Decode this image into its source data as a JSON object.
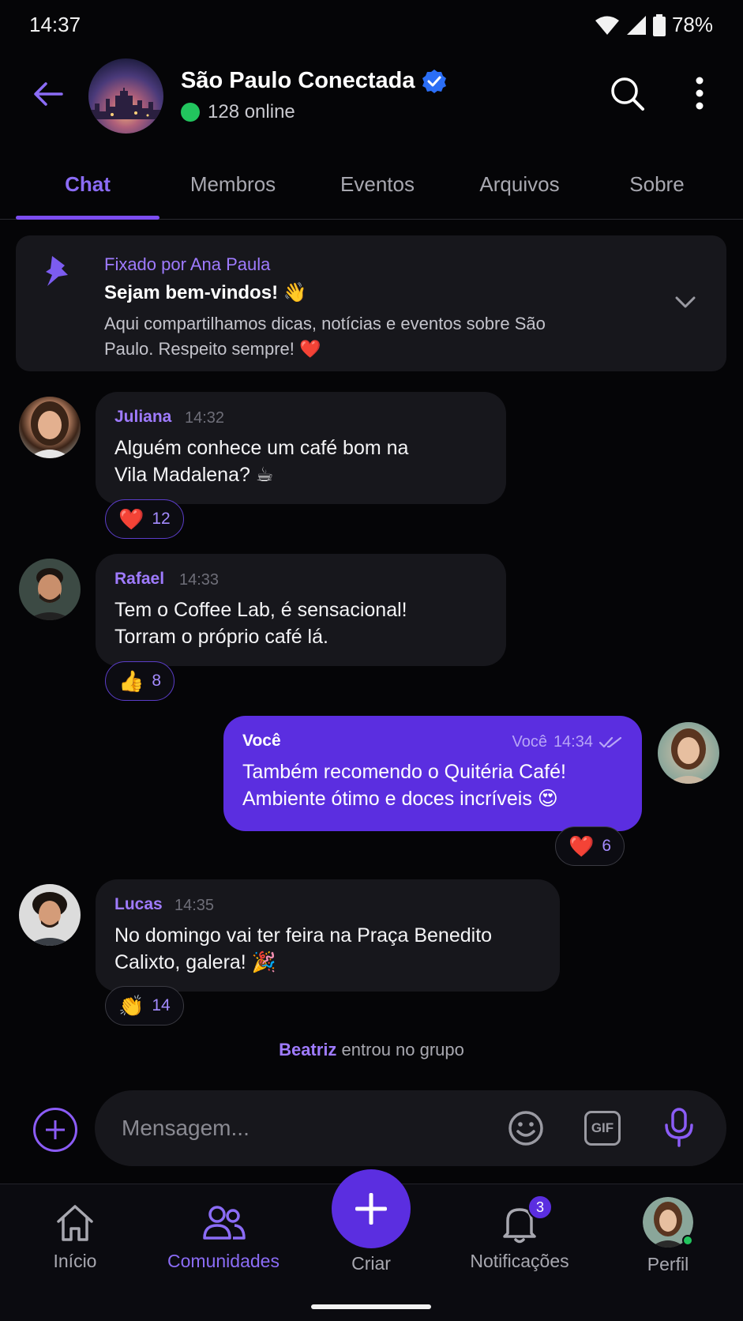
{
  "status_bar": {
    "time": "14:37",
    "battery": "78%"
  },
  "header": {
    "title": "São Paulo Conectada",
    "online": "128 online"
  },
  "tabs": [
    {
      "label": "Chat",
      "active": true
    },
    {
      "label": "Membros"
    },
    {
      "label": "Eventos"
    },
    {
      "label": "Arquivos"
    },
    {
      "label": "Sobre"
    }
  ],
  "pinned": {
    "by": "Fixado por Ana Paula",
    "title": "Sejam bem-vindos! 👋",
    "body": "Aqui compartilhamos dicas, notícias e eventos sobre São Paulo. Respeito sempre! ❤️"
  },
  "messages": [
    {
      "author": "Juliana",
      "time": "14:32",
      "text": "Alguém conhece um café bom na Vila Madalena? ☕",
      "reaction_emoji": "❤️",
      "reaction_count": "12"
    },
    {
      "author": "Rafael",
      "time": "14:33",
      "text": "Tem o Coffee Lab, é sensacional! Torram o próprio café lá.",
      "reaction_emoji": "👍",
      "reaction_count": "8"
    },
    {
      "author": "Você",
      "sender_label": "Você",
      "time": "14:34",
      "text": "Também recomendo o Quitéria Café! Ambiente ótimo e doces incríveis 😍",
      "reaction_emoji": "❤️",
      "reaction_count": "6"
    },
    {
      "author": "Lucas",
      "time": "14:35",
      "text": "No domingo vai ter feira na Praça Benedito Calixto, galera! 🎉",
      "reaction_emoji": "👏",
      "reaction_count": "14"
    }
  ],
  "system": {
    "name": "Beatriz",
    "text": " entrou no grupo"
  },
  "composer": {
    "placeholder": "Mensagem...",
    "gif_label": "GIF"
  },
  "nav": {
    "home": "Início",
    "communities": "Comunidades",
    "create": "Criar",
    "notifications": "Notificações",
    "notifications_badge": "3",
    "profile": "Perfil"
  },
  "colors": {
    "accent": "#5b2ee0",
    "accent_text": "#9f7bff",
    "online": "#22c55e",
    "bubble": "#17171c"
  }
}
